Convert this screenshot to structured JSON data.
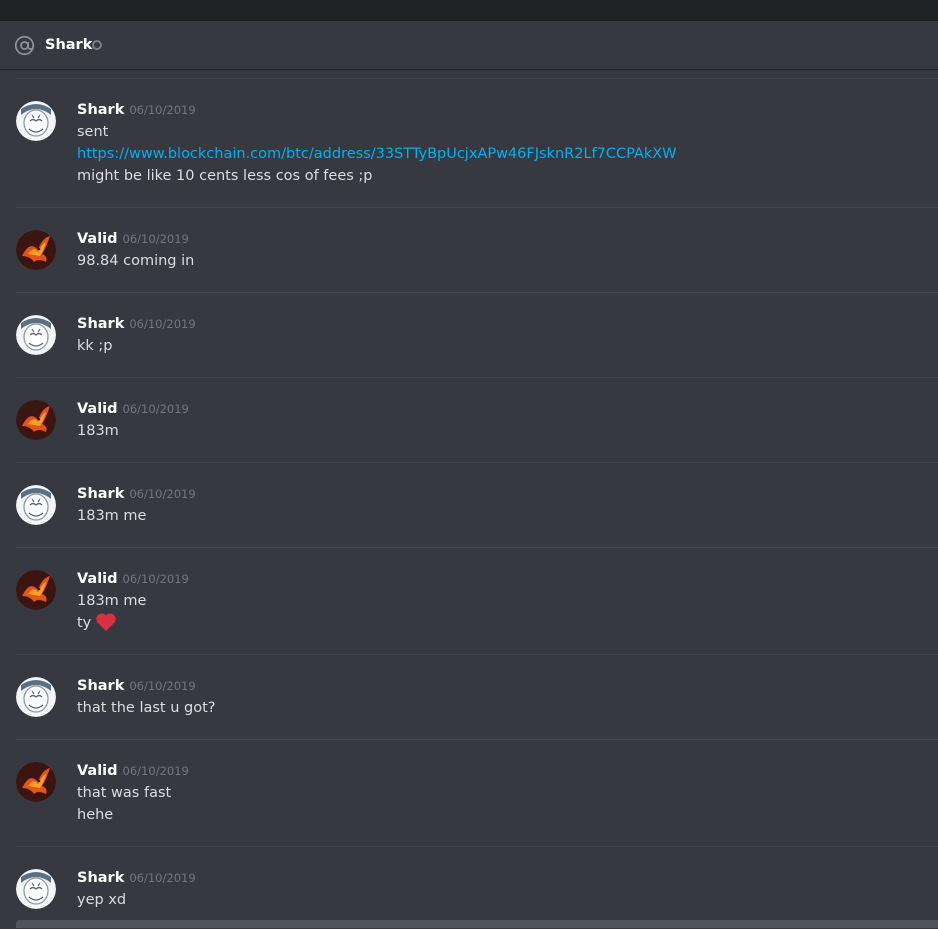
{
  "header": {
    "title": "Shark",
    "icon": "at-icon",
    "status": "offline"
  },
  "messages": [
    {
      "author": "Shark",
      "timestamp": "06/10/2019",
      "lines": [
        "sent",
        "https://www.blockchain.com/btc/address/33STTyBpUcjxAPw46FJsknR2Lf7CCPAkXW",
        "might be like 10 cents less cos of fees ;p"
      ]
    },
    {
      "author": "Valid",
      "timestamp": "06/10/2019",
      "lines": [
        "98.84 coming in"
      ]
    },
    {
      "author": "Shark",
      "timestamp": "06/10/2019",
      "lines": [
        "kk ;p"
      ]
    },
    {
      "author": "Valid",
      "timestamp": "06/10/2019",
      "lines": [
        "183m"
      ]
    },
    {
      "author": "Shark",
      "timestamp": "06/10/2019",
      "lines": [
        "183m me"
      ]
    },
    {
      "author": "Valid",
      "timestamp": "06/10/2019",
      "lines": [
        "183m me",
        "ty"
      ],
      "emoji": "heart-icon"
    },
    {
      "author": "Shark",
      "timestamp": "06/10/2019",
      "lines": [
        "that the last u got?"
      ]
    },
    {
      "author": "Valid",
      "timestamp": "06/10/2019",
      "lines": [
        "that was fast",
        "hehe"
      ]
    },
    {
      "author": "Shark",
      "timestamp": "06/10/2019",
      "lines": [
        "yep xd"
      ]
    }
  ],
  "colors": {
    "background": "#36393f",
    "top_strip": "#202225",
    "link": "#00b0f4",
    "text": "#dcddde",
    "timestamp": "#72767d",
    "heart": "#dd2e44"
  }
}
